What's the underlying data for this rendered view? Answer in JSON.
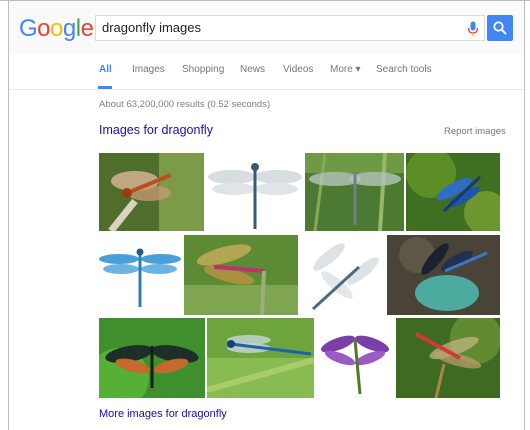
{
  "search": {
    "query": "dragonfly images"
  },
  "tabs": [
    {
      "label": "All"
    },
    {
      "label": "Images"
    },
    {
      "label": "Shopping"
    },
    {
      "label": "News"
    },
    {
      "label": "Videos"
    },
    {
      "label": "More ▾"
    },
    {
      "label": "Search tools"
    }
  ],
  "results": {
    "stats": "About 63,200,000 results (0.52 seconds)"
  },
  "images_section": {
    "title": "Images for dragonfly",
    "report_label": "Report images",
    "more_label": "More images for dragonfly"
  },
  "colors": {
    "google_blue": "#4285f4",
    "google_red": "#ea4335",
    "google_yellow": "#fbbc05",
    "google_green": "#34a853",
    "link": "#1a0dab"
  },
  "logo_letters": [
    "G",
    "o",
    "o",
    "g",
    "l",
    "e"
  ]
}
